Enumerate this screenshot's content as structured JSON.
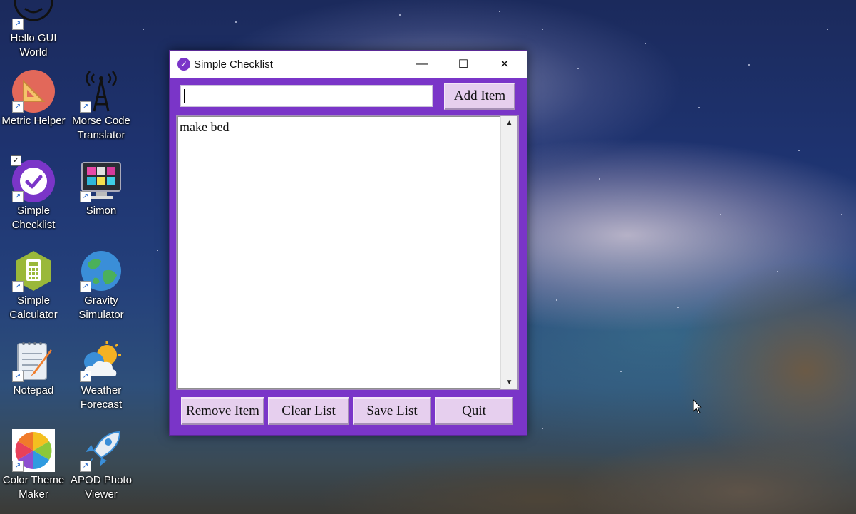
{
  "desktop": {
    "icons": [
      {
        "label": "Hello GUI World",
        "icon": "smiley-icon"
      },
      {
        "label": "Metric Helper",
        "icon": "ruler-triangle-icon"
      },
      {
        "label": "Morse Code Translator",
        "icon": "radio-tower-icon"
      },
      {
        "label": "Simple Checklist",
        "icon": "checkmark-circle-icon"
      },
      {
        "label": "Simon",
        "icon": "monitor-grid-icon"
      },
      {
        "label": "Simple Calculator",
        "icon": "calculator-icon"
      },
      {
        "label": "Gravity Simulator",
        "icon": "globe-icon"
      },
      {
        "label": "Notepad",
        "icon": "notepad-icon"
      },
      {
        "label": "Weather Forecast",
        "icon": "sun-cloud-icon"
      },
      {
        "label": "Color Theme Maker",
        "icon": "color-wheel-icon"
      },
      {
        "label": "APOD Photo Viewer",
        "icon": "rocket-icon"
      }
    ]
  },
  "window": {
    "title": "Simple Checklist",
    "controls": {
      "minimize": "—",
      "maximize": "☐",
      "close": "✕"
    }
  },
  "entry": {
    "value": "",
    "placeholder": ""
  },
  "buttons": {
    "add": "Add Item",
    "remove": "Remove Item",
    "clear": "Clear List",
    "save": "Save List",
    "quit": "Quit"
  },
  "list": {
    "items": [
      "make bed"
    ]
  },
  "colors": {
    "window_bg": "#7a35c8",
    "button_bg": "#e6cfee"
  }
}
